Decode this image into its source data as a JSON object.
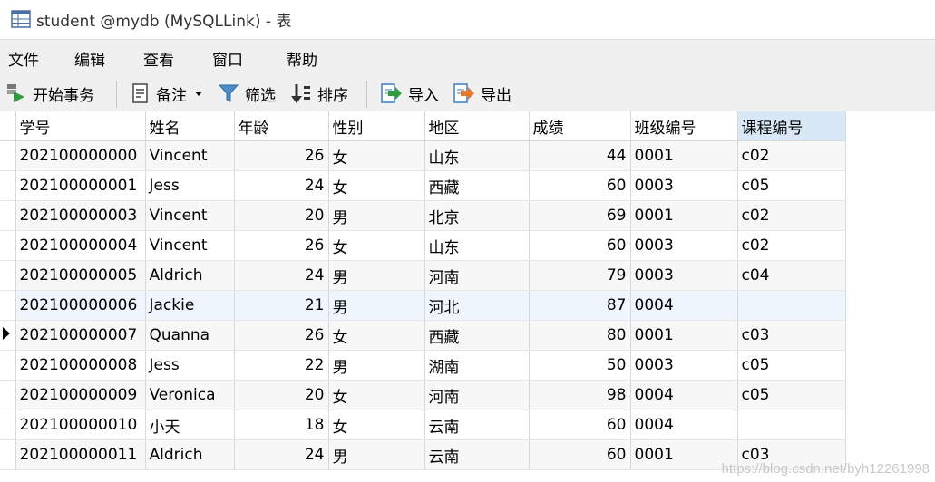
{
  "window": {
    "title": "student @mydb (MySQLLink) - 表"
  },
  "menu": [
    "文件",
    "编辑",
    "查看",
    "窗口",
    "帮助"
  ],
  "toolbar": {
    "begin_transaction": "开始事务",
    "note": "备注",
    "filter": "筛选",
    "sort": "排序",
    "import": "导入",
    "export": "导出"
  },
  "table": {
    "columns": [
      "学号",
      "姓名",
      "年龄",
      "性别",
      "地区",
      "成绩",
      "班级编号",
      "课程编号"
    ],
    "rows": [
      [
        "202100000000",
        "Vincent",
        "26",
        "女",
        "山东",
        "44",
        "0001",
        "c02"
      ],
      [
        "202100000001",
        "Jess",
        "24",
        "女",
        "西藏",
        "60",
        "0003",
        "c05"
      ],
      [
        "202100000003",
        "Vincent",
        "20",
        "男",
        "北京",
        "69",
        "0001",
        "c02"
      ],
      [
        "202100000004",
        "Vincent",
        "26",
        "女",
        "山东",
        "60",
        "0003",
        "c02"
      ],
      [
        "202100000005",
        "Aldrich",
        "24",
        "男",
        "河南",
        "79",
        "0003",
        "c04"
      ],
      [
        "202100000006",
        "Jackie",
        "21",
        "男",
        "河北",
        "87",
        "0004",
        ""
      ],
      [
        "202100000007",
        "Quanna",
        "26",
        "女",
        "西藏",
        "80",
        "0001",
        "c03"
      ],
      [
        "202100000008",
        "Jess",
        "22",
        "男",
        "湖南",
        "50",
        "0003",
        "c05"
      ],
      [
        "202100000009",
        "Veronica",
        "20",
        "女",
        "河南",
        "98",
        "0004",
        "c05"
      ],
      [
        "202100000010",
        "小天",
        "18",
        "女",
        "云南",
        "60",
        "0004",
        ""
      ],
      [
        "202100000011",
        "Aldrich",
        "24",
        "男",
        "云南",
        "60",
        "0001",
        "c03"
      ]
    ]
  },
  "watermark": "https://blog.csdn.net/byh12261998",
  "colors": {
    "header_selected": "#d9e8f6",
    "row_highlight": "#eef5fc",
    "toolbar_bg": "#f0f0f0"
  }
}
